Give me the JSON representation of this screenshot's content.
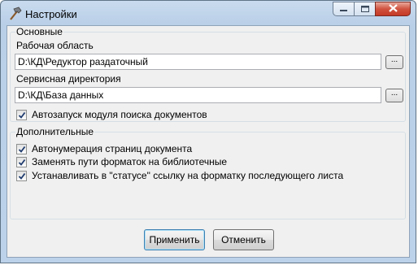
{
  "window": {
    "title": "Настройки"
  },
  "basic": {
    "legend": "Основные",
    "workspace_label": "Рабочая область",
    "workspace_value": "D:\\КД\\Редуктор раздаточный",
    "service_label": "Сервисная директория",
    "service_value": "D:\\КД\\База данных",
    "browse_label": "...",
    "autostart_label": "Автозапуск модуля поиска документов",
    "autostart_checked": true
  },
  "extra": {
    "legend": "Дополнительные",
    "options": [
      {
        "label": "Автонумерация страниц документа",
        "checked": true
      },
      {
        "label": "Заменять пути форматок на библиотечные",
        "checked": true
      },
      {
        "label": "Устанавливать в \"статусе\" ссылку на форматку последующего листа",
        "checked": true
      }
    ]
  },
  "buttons": {
    "apply": "Применить",
    "cancel": "Отменить"
  }
}
